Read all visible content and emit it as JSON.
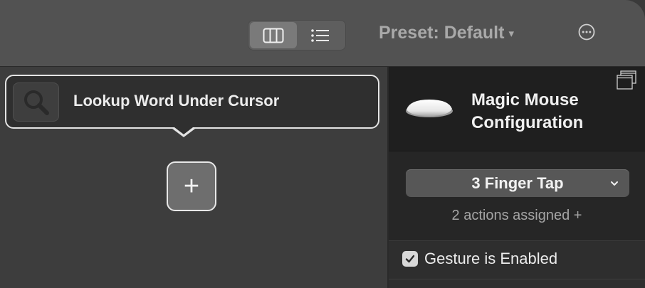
{
  "toolbar": {
    "view_modes": [
      {
        "name": "columns",
        "icon": "columns-icon",
        "selected": true
      },
      {
        "name": "list",
        "icon": "list-icon",
        "selected": false
      }
    ],
    "preset_label": "Preset: Default",
    "preset_caret": "▾",
    "more_icon": "ellipsis-circle-icon"
  },
  "actions_area": {
    "action": {
      "icon": "magnifying-glass-icon",
      "label": "Lookup Word Under Cursor"
    },
    "add_button_label": "+"
  },
  "device_panel": {
    "window_icon": "copy-window-icon",
    "device_image": "magic-mouse-icon",
    "title": "Magic Mouse Configuration",
    "gesture": "3 Finger Tap",
    "actions_assigned": "2 actions assigned +",
    "gesture_enabled_label": "Gesture is Enabled",
    "gesture_enabled": true
  },
  "colors": {
    "toolbar_bg": "#525252",
    "panel_dark": "#1f1f1f",
    "card_border": "#e4e4e4"
  }
}
